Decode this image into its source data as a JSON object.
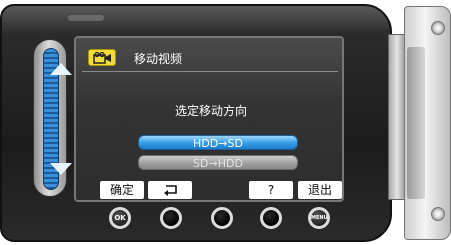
{
  "header": {
    "title": "移动视频"
  },
  "prompt": "选定移动方向",
  "options": [
    {
      "label": "HDD→SD",
      "selected": true
    },
    {
      "label": "SD→HDD",
      "selected": false
    }
  ],
  "softkeys": {
    "ok_label": "确定",
    "back_icon": "return-arrow",
    "help_label": "?",
    "exit_label": "退出"
  },
  "hardware_buttons": {
    "ok": "OK",
    "menu": "MENU"
  },
  "colors": {
    "screen_bg": "#343434",
    "selected_option": "#3aa0e8",
    "unselected_option": "#9b9b9b",
    "header_icon": "#f2dc3a"
  }
}
